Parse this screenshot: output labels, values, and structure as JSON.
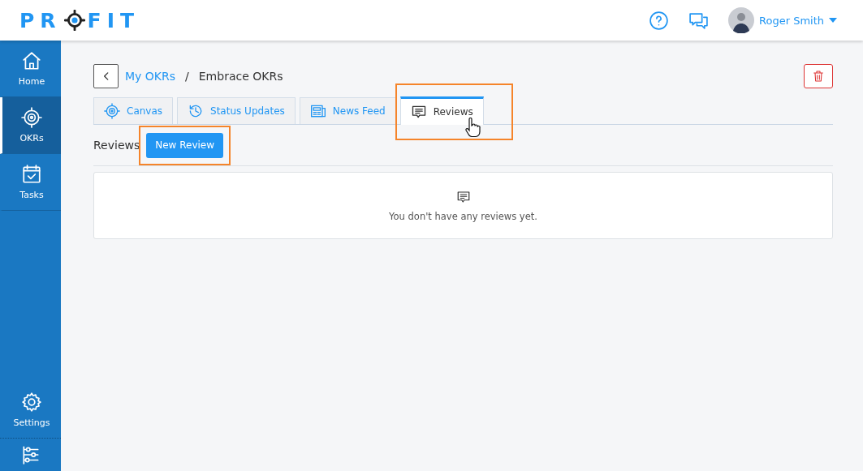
{
  "header": {
    "logo": [
      "PR",
      "FIT"
    ],
    "user": {
      "name": "Roger Smith"
    }
  },
  "sidebar": {
    "items": [
      {
        "label": "Home",
        "kind": "home",
        "selected": false
      },
      {
        "label": "OKRs",
        "kind": "target",
        "selected": true
      },
      {
        "label": "Tasks",
        "kind": "tasks",
        "selected": false
      }
    ],
    "bottom_items": [
      {
        "label": "Settings",
        "kind": "gear"
      }
    ]
  },
  "breadcrumb": {
    "parent": "My OKRs",
    "separator": "/",
    "current": "Embrace OKRs"
  },
  "tabs": [
    {
      "label": "Canvas",
      "kind": "target",
      "selected": false
    },
    {
      "label": "Status Updates",
      "kind": "history",
      "selected": false
    },
    {
      "label": "News Feed",
      "kind": "news",
      "selected": false
    },
    {
      "label": "Reviews",
      "kind": "comment",
      "selected": true,
      "highlighted": true
    }
  ],
  "section": {
    "title": "Reviews",
    "button": "New Review",
    "button_highlighted": true
  },
  "empty_state": {
    "message": "You don't have any reviews yet."
  }
}
